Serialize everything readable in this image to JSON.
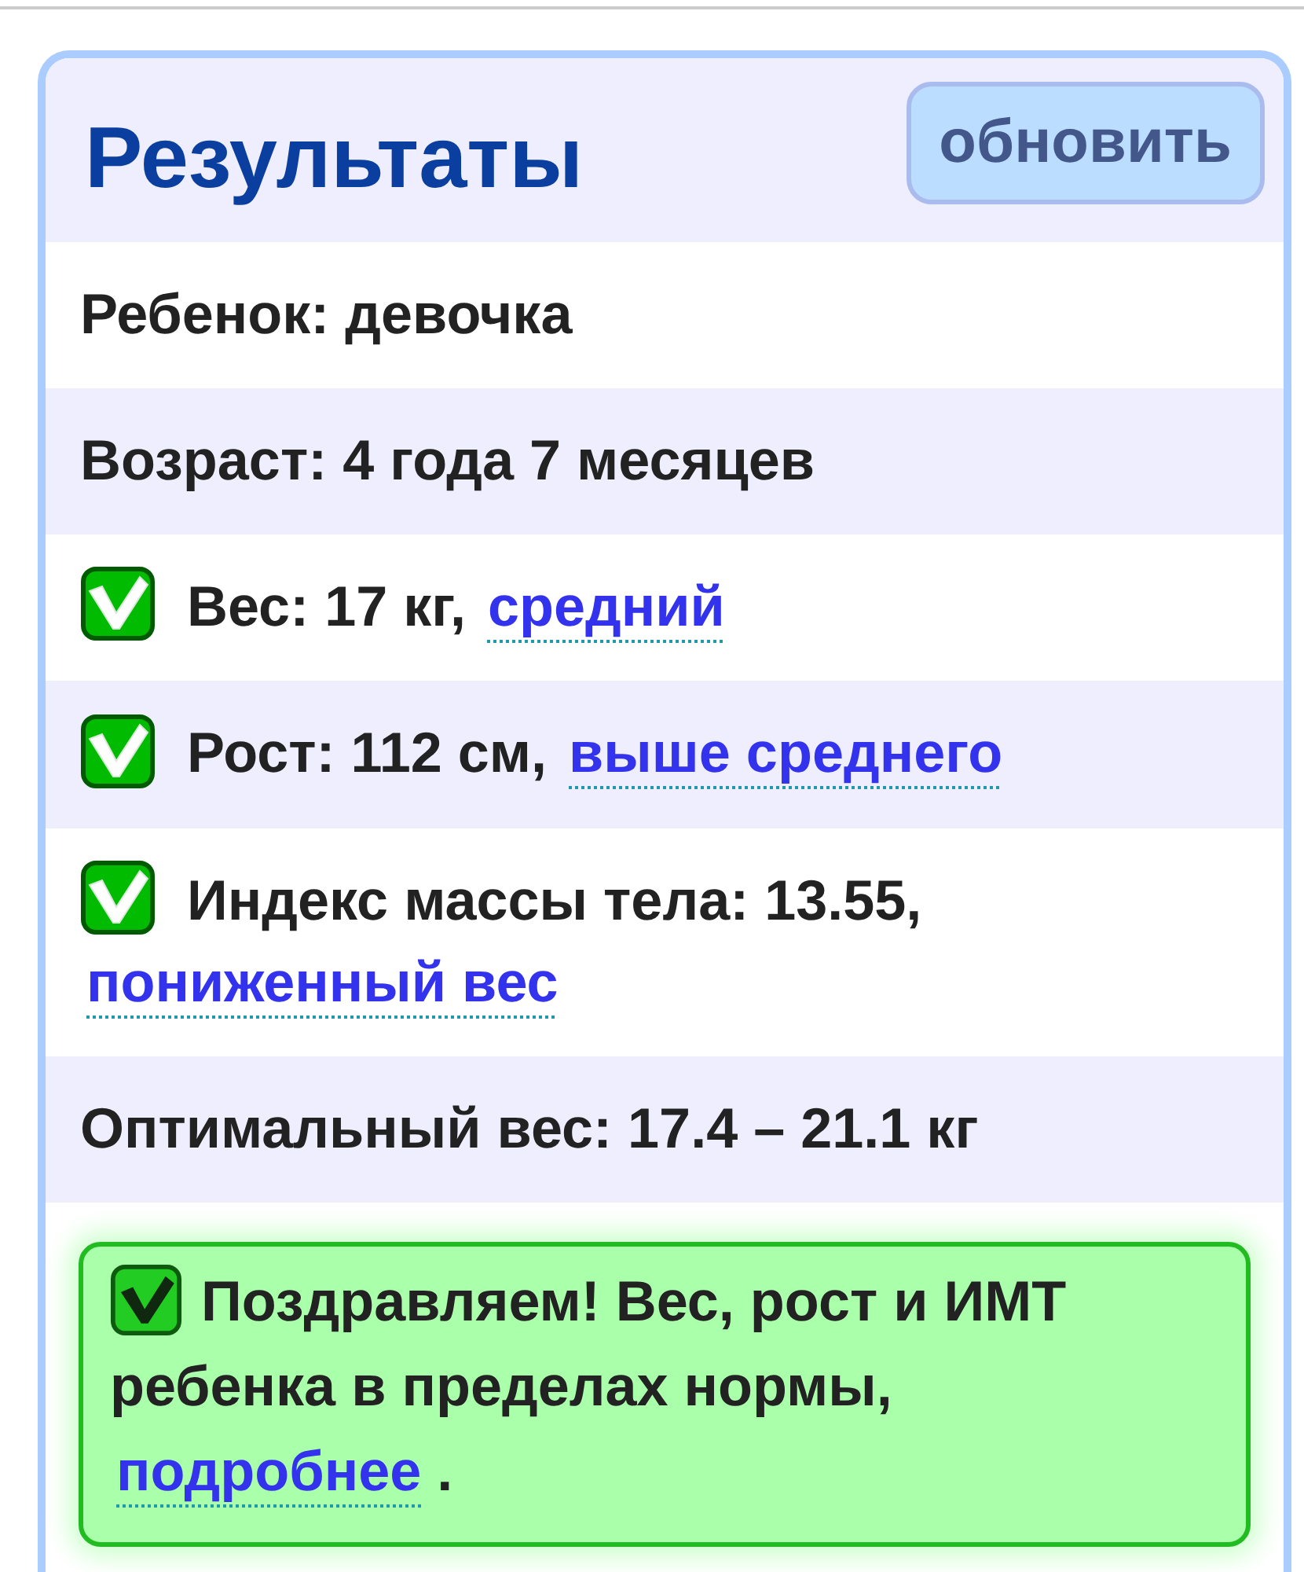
{
  "header": {
    "title": "Результаты",
    "refresh_button": "обновить"
  },
  "rows": [
    {
      "kind": "text",
      "label": "Ребенок: девочка"
    },
    {
      "kind": "text",
      "label": "Возраст: 4 года 7 месяцев"
    },
    {
      "kind": "check",
      "checked": true,
      "label": "Вес: 17 кг,",
      "link": "средний"
    },
    {
      "kind": "check",
      "checked": true,
      "label": "Рост: 112 см,",
      "link": "выше среднего"
    },
    {
      "kind": "check",
      "checked": true,
      "label": "Индекс массы тела: 13.55,",
      "link": "пониженный вес"
    },
    {
      "kind": "text",
      "label": "Оптимальный вес: 17.4 – 21.1 кг"
    }
  ],
  "notice": {
    "text": "Поздравляем! Вес, рост и ИМТ ребенка в пределах нормы,",
    "link": "подробнее",
    "tail": "."
  }
}
